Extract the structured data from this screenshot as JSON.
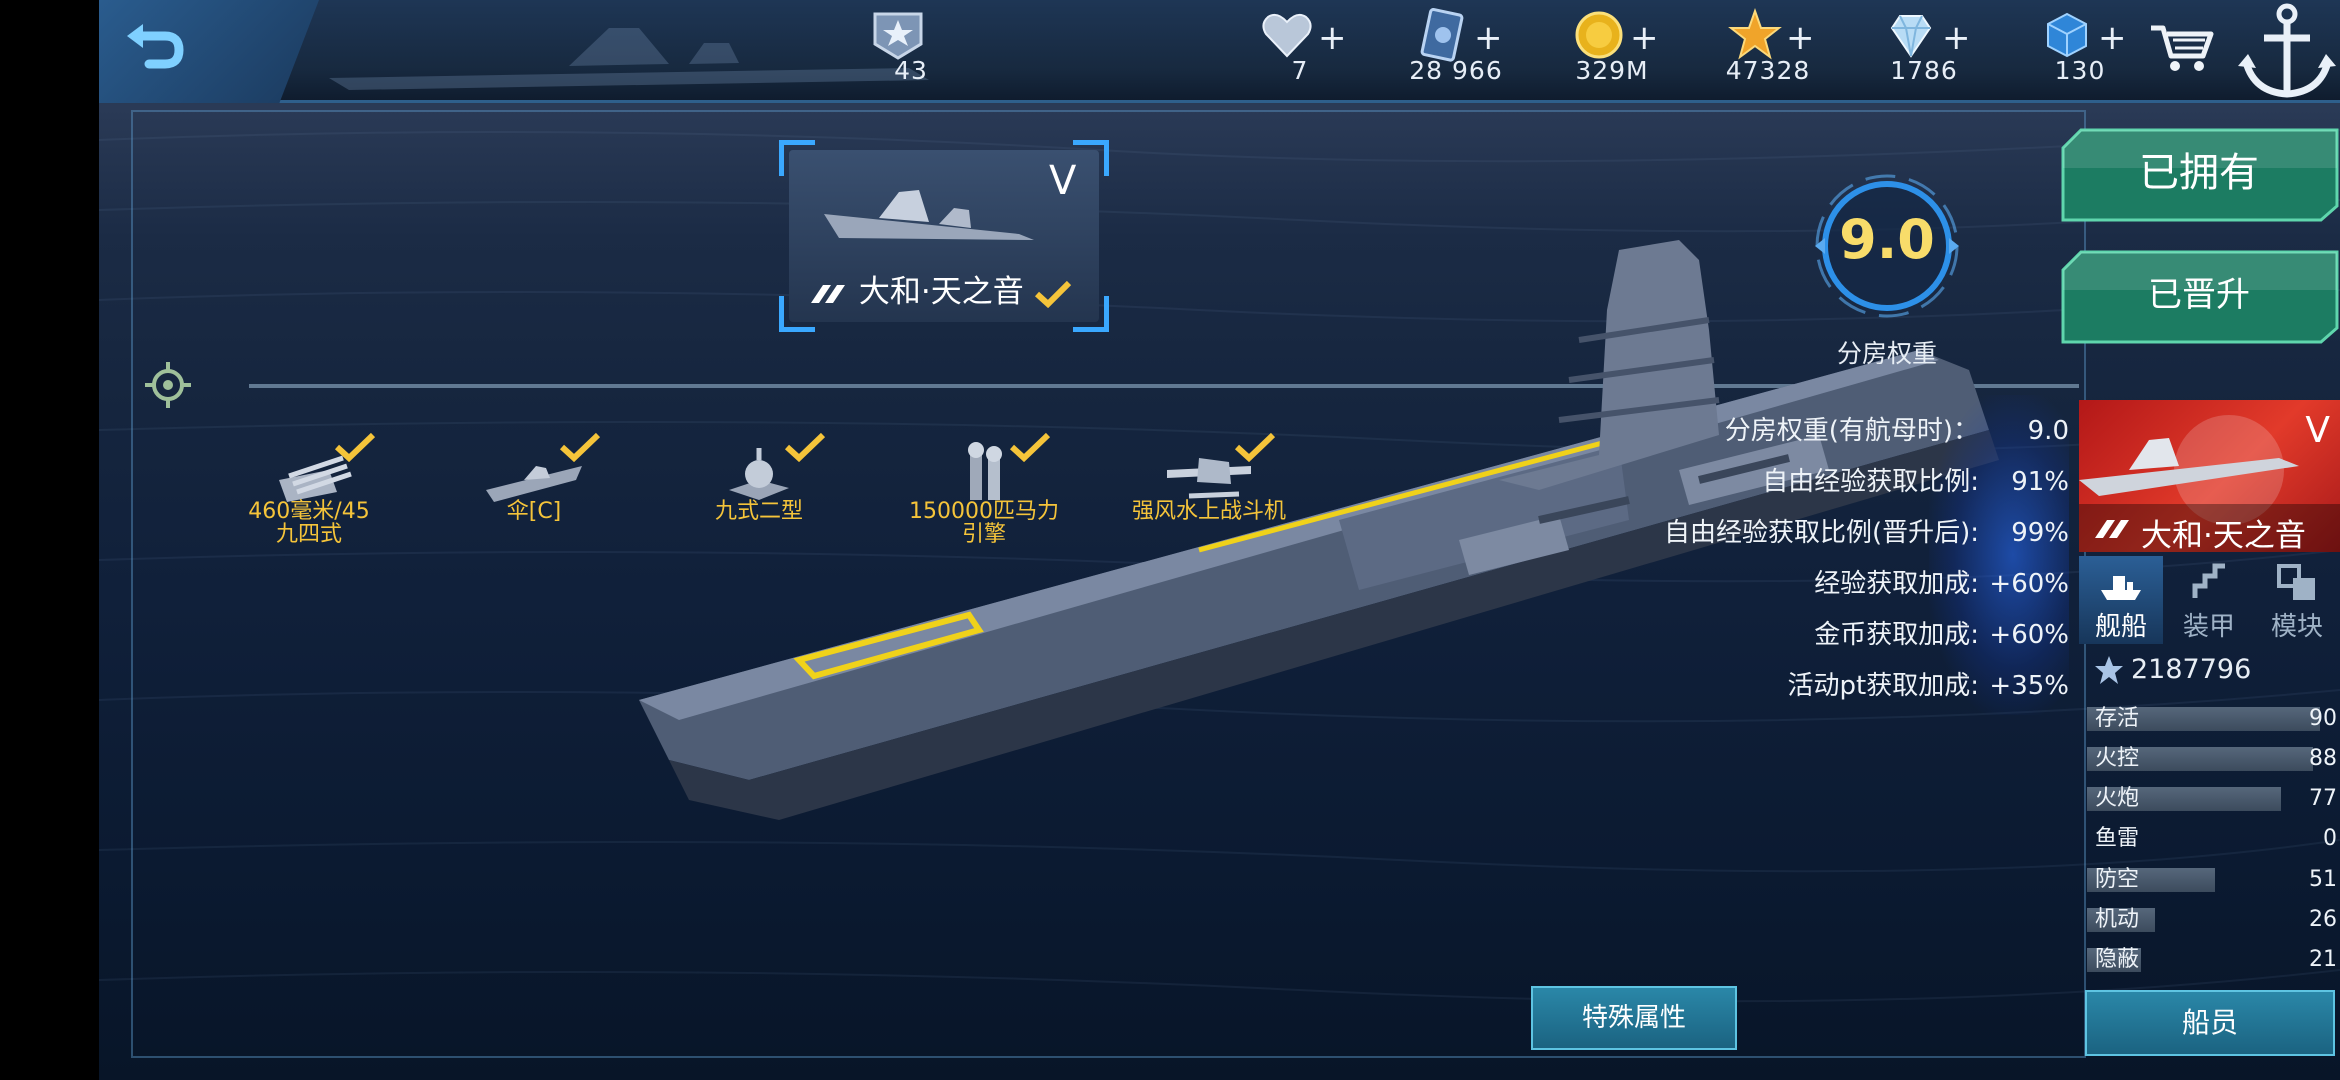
{
  "topbar": {
    "rank": {
      "icon": "rank-badge-icon",
      "value": "43"
    },
    "resources": [
      {
        "name": "heart-icon",
        "value": "7"
      },
      {
        "name": "card-icon",
        "value": "28 966"
      },
      {
        "name": "gold-coin-icon",
        "value": "329M"
      },
      {
        "name": "star-icon",
        "value": "47328"
      },
      {
        "name": "diamond-icon",
        "value": "1786"
      },
      {
        "name": "cube-icon",
        "value": "130"
      }
    ],
    "plus": "+"
  },
  "ship_card": {
    "tier": "V",
    "name": "大和·天之音"
  },
  "equipment": [
    {
      "label": "460毫米/45\n九四式",
      "icon": "gun-turret-icon"
    },
    {
      "label": "伞[C]",
      "icon": "ship-hull-icon"
    },
    {
      "label": "九式二型",
      "icon": "fire-control-icon"
    },
    {
      "label": "150000匹马力\n引擎",
      "icon": "engine-icon"
    },
    {
      "label": "强风水上战斗机",
      "icon": "seaplane-icon"
    }
  ],
  "rating": {
    "value": "9.0",
    "label": "分房权重"
  },
  "stats": [
    {
      "key": "分房权重(有航母时)：",
      "value": "9.0"
    },
    {
      "key": "自由经验获取比例:",
      "value": "91%"
    },
    {
      "key": "自由经验获取比例(晋升后):",
      "value": "99%"
    },
    {
      "key": "经验获取加成:",
      "value": "+60%"
    },
    {
      "key": "金币获取加成:",
      "value": "+60%"
    },
    {
      "key": "活动pt获取加成:",
      "value": "+35%"
    }
  ],
  "buttons": {
    "owned": "已拥有",
    "promoted": "已晋升",
    "special": "特殊属性",
    "crew": "船员"
  },
  "portrait": {
    "tier": "V",
    "name": "大和·天之音"
  },
  "tabs": [
    {
      "label": "舰船",
      "icon": "ship-tab-icon",
      "active": true
    },
    {
      "label": "装甲",
      "icon": "armor-tab-icon",
      "active": false
    },
    {
      "label": "模块",
      "icon": "module-tab-icon",
      "active": false
    }
  ],
  "score": "2187796",
  "attributes": [
    {
      "label": "存活",
      "value": "90"
    },
    {
      "label": "火控",
      "value": "88"
    },
    {
      "label": "火炮",
      "value": "77"
    },
    {
      "label": "鱼雷",
      "value": "0"
    },
    {
      "label": "防空",
      "value": "51"
    },
    {
      "label": "机动",
      "value": "26"
    },
    {
      "label": "隐蔽",
      "value": "21"
    }
  ],
  "colors": {
    "accent_gold": "#f5c43a",
    "button_green": "#1f8a6a",
    "button_teal": "#1f7596",
    "portrait_red": "#d42a22"
  }
}
